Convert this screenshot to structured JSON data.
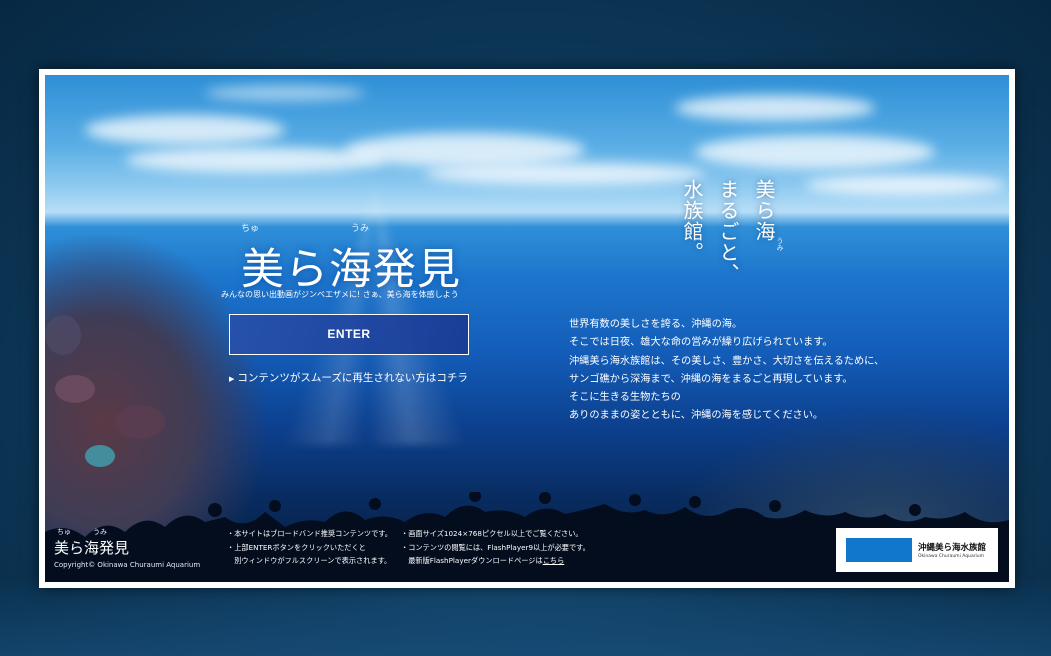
{
  "hero": {
    "logo_ruby_1": "ちゅ",
    "logo_ruby_2": "うみ",
    "logo_title": "美ら海発見",
    "logo_subtitle": "みんなの思い出動画がジンベエザメに! さぁ、美ら海を体感しよう",
    "enter_label": "ENTER",
    "help_link_label": "コンテンツがスムーズに再生されない方はコチラ"
  },
  "vertical_text": {
    "line1": "美ら海",
    "line1_ruby": "うみ",
    "line2": "まるごと、",
    "line3": "水族館。"
  },
  "description": {
    "lines": [
      "世界有数の美しさを誇る、沖縄の海。",
      "そこでは日夜、雄大な命の営みが繰り広げられています。",
      "沖縄美ら海水族館は、その美しさ、豊かさ、大切さを伝えるために、",
      "サンゴ礁から深海まで、沖縄の海をまるごと再現しています。",
      "そこに生きる生物たちの",
      "ありのままの姿とともに、沖縄の海を感じてください。"
    ]
  },
  "footer": {
    "title_ruby_1": "ちゅ",
    "title_ruby_2": "うみ",
    "title": "美ら海発見",
    "copyright": "Copyright© Okinawa Churaumi Aquarium",
    "notes_left": [
      "・本サイトはブロードバンド推奨コンテンツです。",
      "・上部ENTERボタンをクリックいただくと",
      "　別ウィンドウがフルスクリーンで表示されます。"
    ],
    "notes_right_1": "・画面サイズ1024×768ピクセル以上でご覧ください。",
    "notes_right_2": "・コンテンツの閲覧には、FlashPlayer9以上が必要です。",
    "notes_right_3_prefix": "　最新版FlashPlayerダウンロードページは",
    "notes_right_3_link": "こちら"
  },
  "brand": {
    "name": "沖縄美ら海水族館",
    "name_en": "Okinawa Churaumi Aquarium"
  },
  "colors": {
    "page_bg": "#0f3c5f",
    "ocean_blue": "#135cb8",
    "button_bg": "#2a50aa",
    "brand_blue": "#1177cc"
  }
}
